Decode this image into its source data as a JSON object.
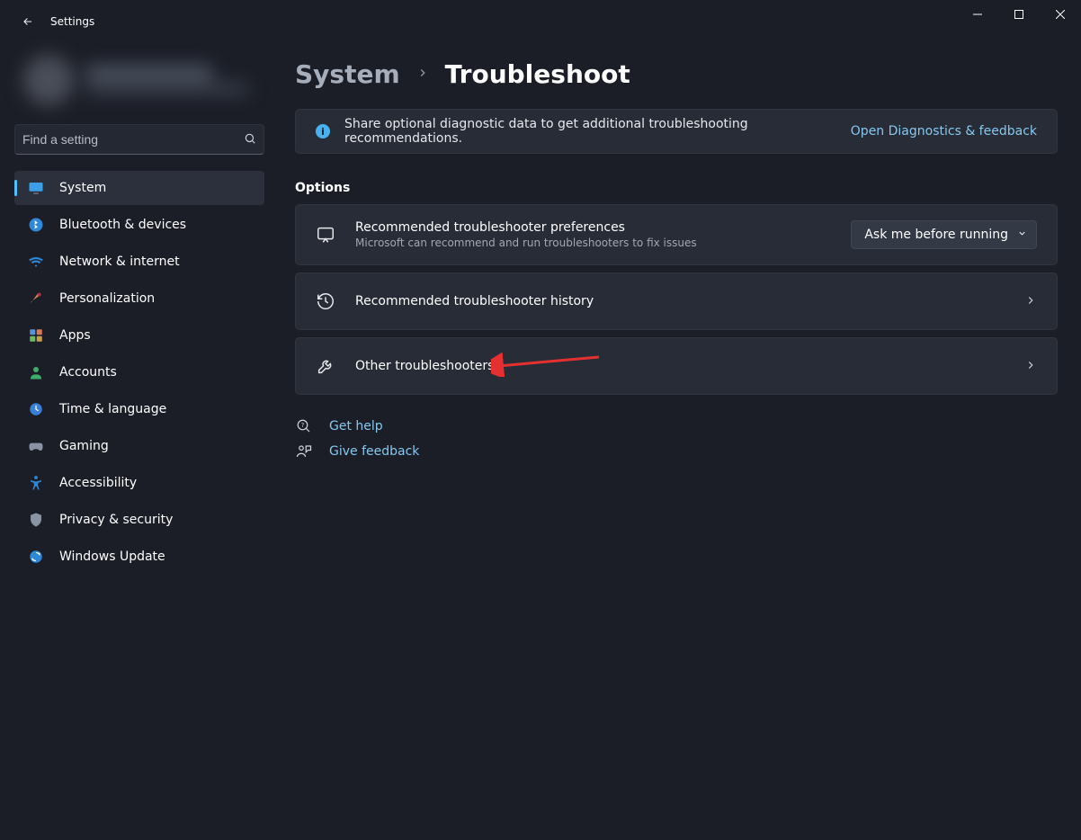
{
  "app_title": "Settings",
  "search": {
    "placeholder": "Find a setting"
  },
  "nav": [
    {
      "label": "System"
    },
    {
      "label": "Bluetooth & devices"
    },
    {
      "label": "Network & internet"
    },
    {
      "label": "Personalization"
    },
    {
      "label": "Apps"
    },
    {
      "label": "Accounts"
    },
    {
      "label": "Time & language"
    },
    {
      "label": "Gaming"
    },
    {
      "label": "Accessibility"
    },
    {
      "label": "Privacy & security"
    },
    {
      "label": "Windows Update"
    }
  ],
  "breadcrumb": {
    "parent": "System",
    "current": "Troubleshoot"
  },
  "info_banner": {
    "text": "Share optional diagnostic data to get additional troubleshooting recommendations.",
    "link": "Open Diagnostics & feedback"
  },
  "section_heading": "Options",
  "cards": {
    "preferences": {
      "title": "Recommended troubleshooter preferences",
      "sub": "Microsoft can recommend and run troubleshooters to fix issues",
      "dropdown_value": "Ask me before running"
    },
    "history": {
      "title": "Recommended troubleshooter history"
    },
    "other": {
      "title": "Other troubleshooters"
    }
  },
  "help": {
    "get_help": "Get help",
    "give_feedback": "Give feedback"
  }
}
